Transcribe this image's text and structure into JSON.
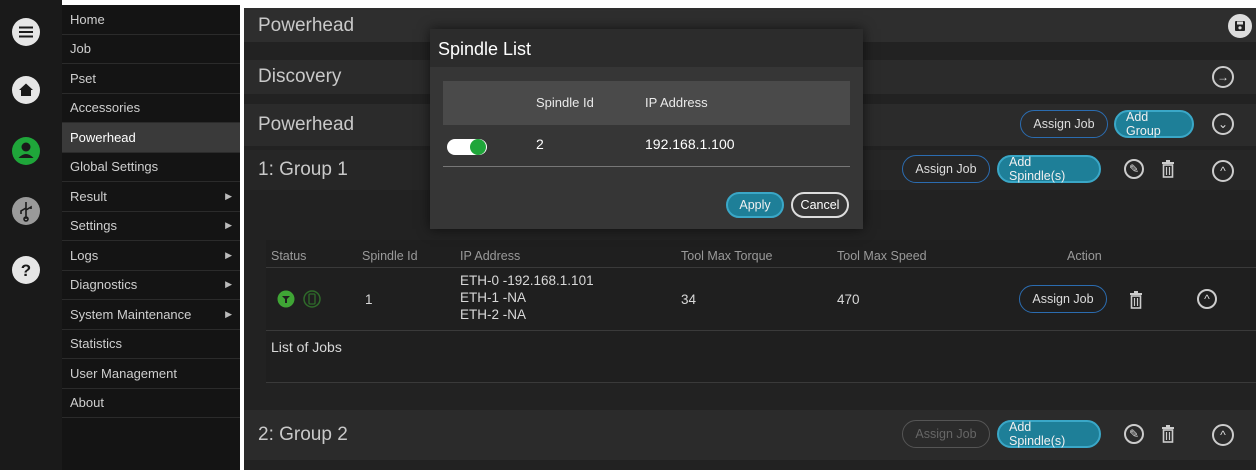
{
  "sidebar_menu": {
    "items": [
      {
        "label": "Home",
        "submenu": false,
        "active": false
      },
      {
        "label": "Job",
        "submenu": false,
        "active": false
      },
      {
        "label": "Pset",
        "submenu": false,
        "active": false
      },
      {
        "label": "Accessories",
        "submenu": false,
        "active": false
      },
      {
        "label": "Powerhead",
        "submenu": false,
        "active": true
      },
      {
        "label": "Global Settings",
        "submenu": false,
        "active": false
      },
      {
        "label": "Result",
        "submenu": true,
        "active": false
      },
      {
        "label": "Settings",
        "submenu": true,
        "active": false
      },
      {
        "label": "Logs",
        "submenu": true,
        "active": false
      },
      {
        "label": "Diagnostics",
        "submenu": true,
        "active": false
      },
      {
        "label": "System Maintenance",
        "submenu": true,
        "active": false
      },
      {
        "label": "Statistics",
        "submenu": false,
        "active": false
      },
      {
        "label": "User Management",
        "submenu": false,
        "active": false
      },
      {
        "label": "About",
        "submenu": false,
        "active": false
      }
    ],
    "arrow_glyph": "▶"
  },
  "rail_icons": [
    "menu-icon",
    "home-icon",
    "user-icon",
    "usb-icon",
    "help-icon"
  ],
  "header": {
    "title": "Powerhead"
  },
  "discovery": {
    "title": "Discovery"
  },
  "powerhead_section": {
    "title": "Powerhead",
    "assign_job": "Assign Job",
    "add_group": "Add Group"
  },
  "group1": {
    "title": "1: Group 1",
    "assign_job": "Assign Job",
    "add_spindles": "Add Spindle(s)",
    "table": {
      "headers": [
        "Status",
        "Spindle Id",
        "IP Address",
        "Tool Max Torque",
        "Tool Max Speed",
        "Action"
      ],
      "row": {
        "spindle_id": "1",
        "ip_lines": [
          "ETH-0 -192.168.1.101",
          "ETH-1 -NA",
          "ETH-2 -NA"
        ],
        "torque": "34",
        "speed": "470",
        "assign_job": "Assign Job"
      },
      "jobs_label": "List of Jobs"
    }
  },
  "group2": {
    "title": "2: Group 2",
    "assign_job": "Assign Job",
    "add_spindles": "Add Spindle(s)"
  },
  "modal": {
    "title": "Spindle List",
    "headers": [
      "Spindle Id",
      "IP Address"
    ],
    "row": {
      "enabled": true,
      "spindle_id": "2",
      "ip": "192.168.1.100"
    },
    "apply": "Apply",
    "cancel": "Cancel"
  },
  "colors": {
    "accent": "#1e7f98",
    "toggle_on": "#1fa63a",
    "user_icon": "#1fa63a"
  }
}
